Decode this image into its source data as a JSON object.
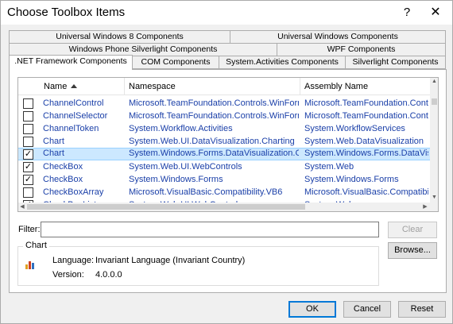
{
  "window": {
    "title": "Choose Toolbox Items",
    "help_glyph": "?",
    "close_glyph": "✕"
  },
  "tabs": {
    "row1": [
      "Universal Windows 8 Components",
      "Universal Windows Components"
    ],
    "row2": [
      "Windows Phone Silverlight Components",
      "WPF Components"
    ],
    "row3": [
      ".NET Framework Components",
      "COM Components",
      "System.Activities Components",
      "Silverlight Components"
    ],
    "active": ".NET Framework Components"
  },
  "grid": {
    "columns": {
      "name": "Name",
      "namespace": "Namespace",
      "assembly": "Assembly Name"
    },
    "sort_column": "name",
    "rows": [
      {
        "checked": false,
        "name": "ChannelControl",
        "namespace": "Microsoft.TeamFoundation.Controls.WinForms",
        "assembly": "Microsoft.TeamFoundation.Contr"
      },
      {
        "checked": false,
        "name": "ChannelSelector",
        "namespace": "Microsoft.TeamFoundation.Controls.WinForms",
        "assembly": "Microsoft.TeamFoundation.Contr"
      },
      {
        "checked": false,
        "name": "ChannelToken",
        "namespace": "System.Workflow.Activities",
        "assembly": "System.WorkflowServices"
      },
      {
        "checked": false,
        "name": "Chart",
        "namespace": "System.Web.UI.DataVisualization.Charting",
        "assembly": "System.Web.DataVisualization"
      },
      {
        "checked": true,
        "selected": true,
        "name": "Chart",
        "namespace": "System.Windows.Forms.DataVisualization.Chart",
        "assembly": "System.Windows.Forms.DataVisua"
      },
      {
        "checked": true,
        "name": "CheckBox",
        "namespace": "System.Web.UI.WebControls",
        "assembly": "System.Web"
      },
      {
        "checked": true,
        "name": "CheckBox",
        "namespace": "System.Windows.Forms",
        "assembly": "System.Windows.Forms"
      },
      {
        "checked": false,
        "name": "CheckBoxArray",
        "namespace": "Microsoft.VisualBasic.Compatibility.VB6",
        "assembly": "Microsoft.VisualBasic.Compatibilit"
      },
      {
        "checked": true,
        "name": "CheckBoxList",
        "namespace": "System.Web.UI.WebControls",
        "assembly": "System.Web"
      }
    ]
  },
  "filter": {
    "label": "Filter:",
    "value": "",
    "clear_label": "Clear"
  },
  "details": {
    "group_title": "Chart",
    "language_label": "Language:",
    "language_value": "Invariant Language (Invariant Country)",
    "version_label": "Version:",
    "version_value": "4.0.0.0",
    "icon": "chart-icon"
  },
  "buttons": {
    "browse": "Browse...",
    "ok": "OK",
    "cancel": "Cancel",
    "reset": "Reset"
  },
  "colors": {
    "link_text": "#1a3fa8",
    "selection": "#cce8ff",
    "selection_border": "#99d1ff",
    "default_button_border": "#0078d7"
  }
}
